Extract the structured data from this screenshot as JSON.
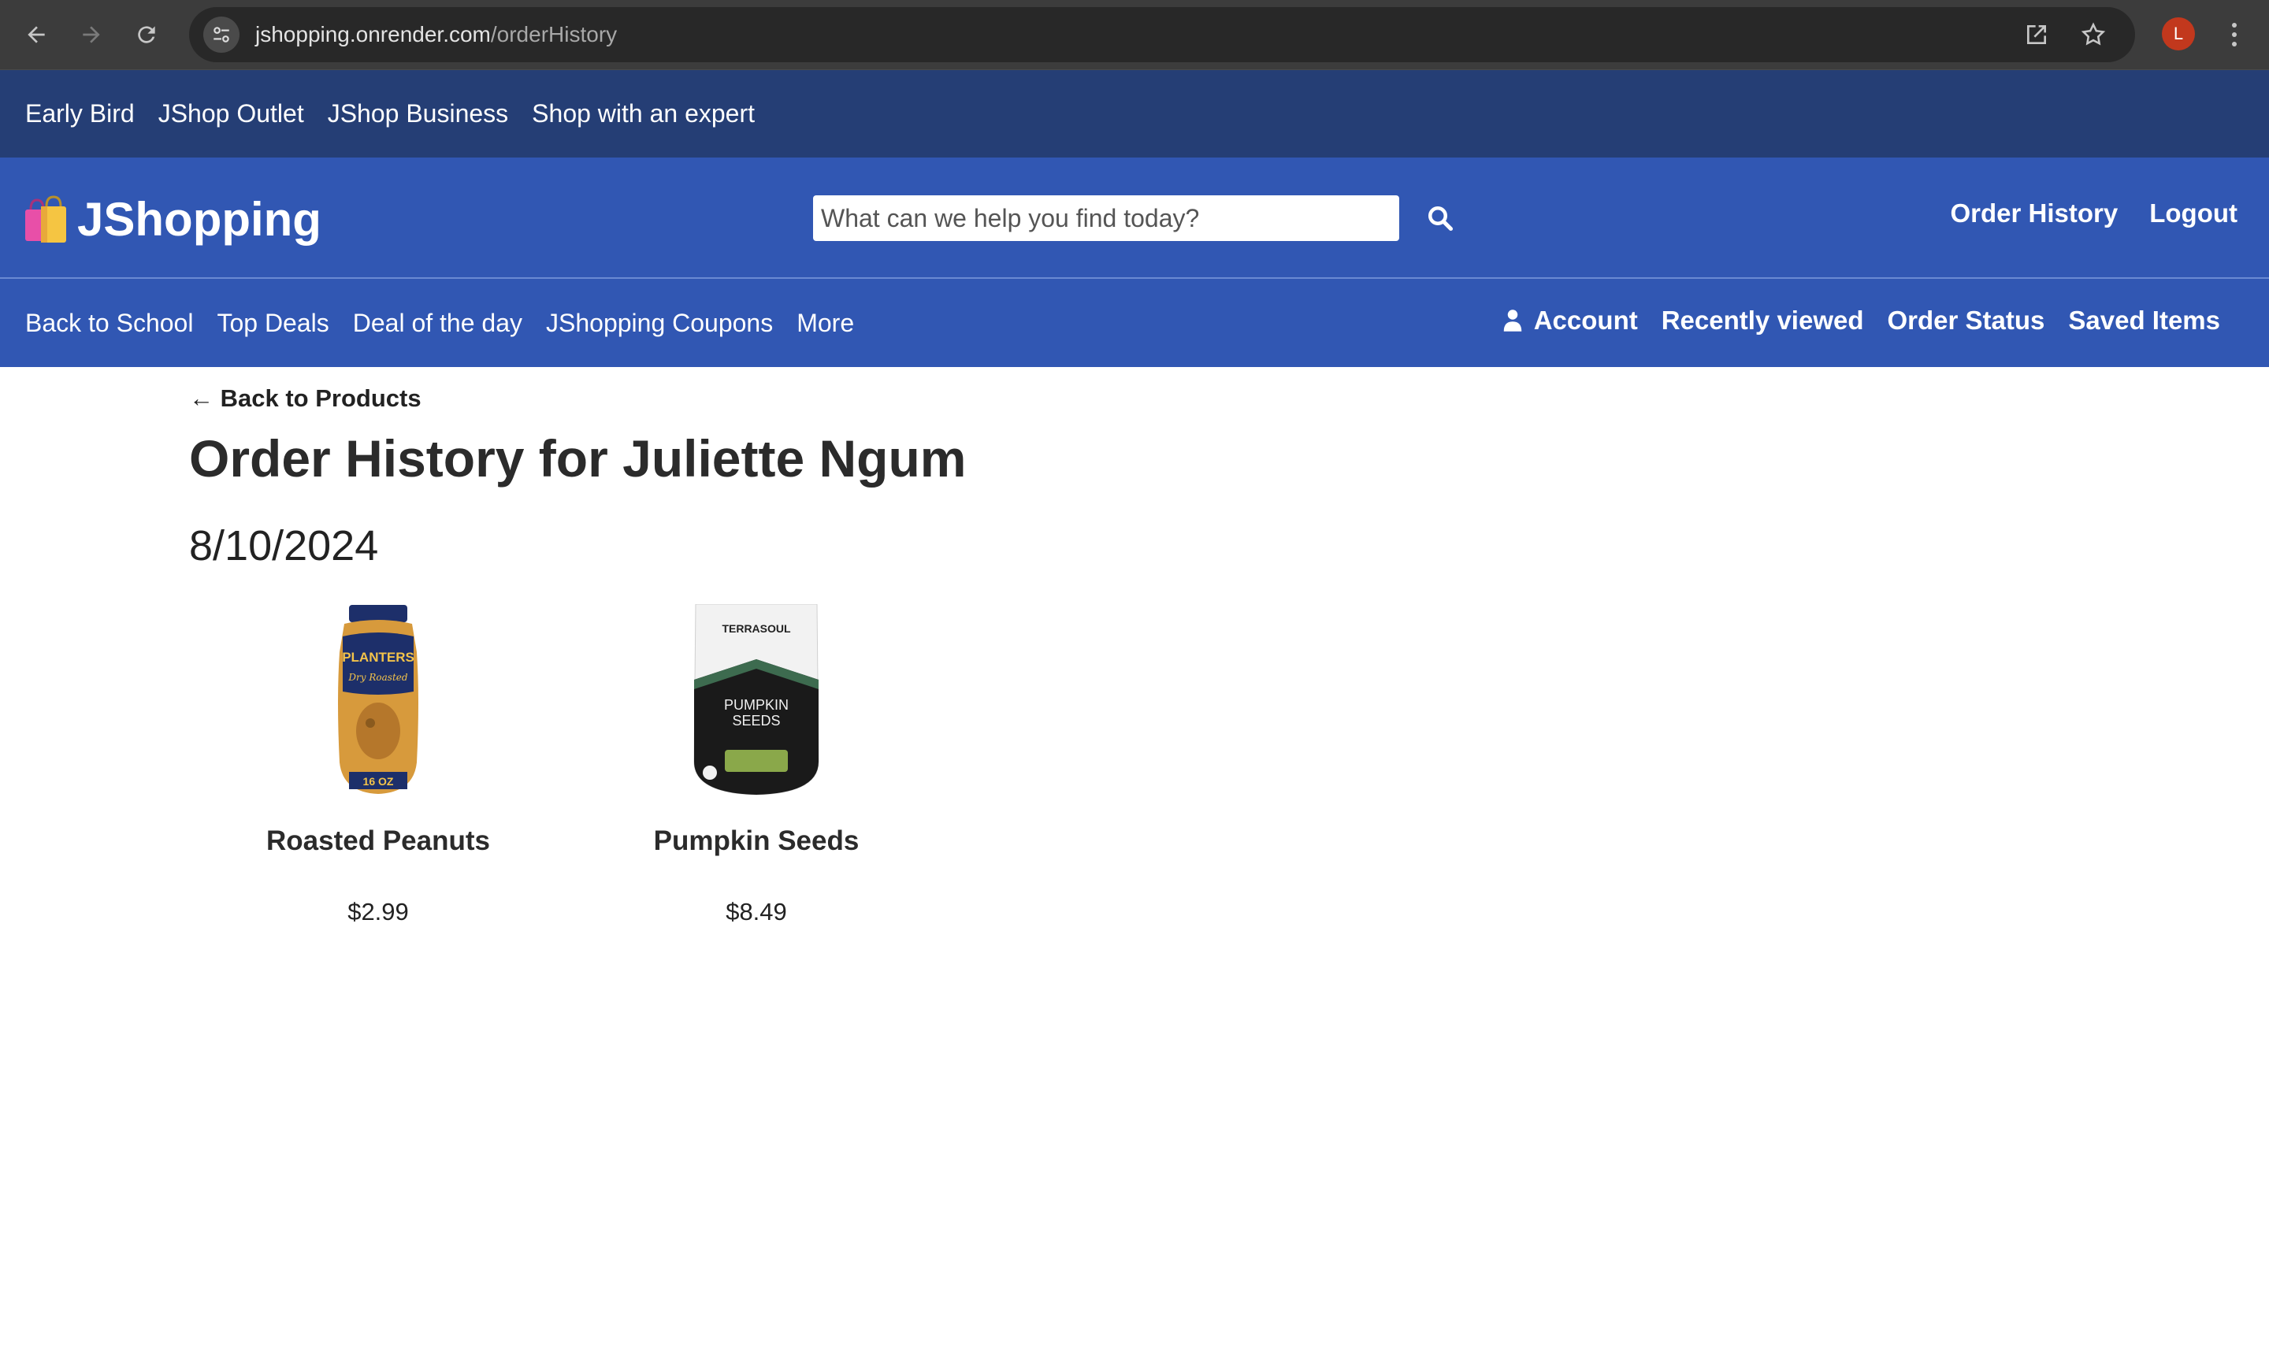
{
  "browser": {
    "url_host": "jshopping.onrender.com",
    "url_path": "/orderHistory",
    "profile_initial": "L"
  },
  "promo_bar": {
    "items": [
      "Early Bird",
      "JShop Outlet",
      "JShop Business",
      "Shop with an expert"
    ]
  },
  "header": {
    "logo_text": "JShopping",
    "search_placeholder": "What can we help you find today?",
    "links": [
      "Order History",
      "Logout"
    ]
  },
  "category_nav": {
    "left": [
      "Back to School",
      "Top Deals",
      "Deal of the day",
      "JShopping Coupons",
      "More"
    ],
    "right": [
      "Account",
      "Recently viewed",
      "Order Status",
      "Saved Items"
    ]
  },
  "content": {
    "back_link": "← Back to Products",
    "title": "Order History for Juliette Ngum",
    "order_date": "8/10/2024",
    "products": [
      {
        "name": "Roasted Peanuts",
        "price": "$2.99",
        "icon": "peanuts-jar-image",
        "label_top": "PLANTERS",
        "label_mid": "Dry Roasted",
        "label_bottom": "16 OZ"
      },
      {
        "name": "Pumpkin Seeds",
        "price": "$8.49",
        "icon": "pumpkin-seeds-bag-image",
        "label_top": "TERRASOUL",
        "label_mid": "PUMPKIN",
        "label_bottom": "SEEDS"
      }
    ]
  },
  "colors": {
    "promo_bg": "#253e75",
    "header_bg": "#3157b3",
    "browser_bg": "#3c3c3c"
  }
}
